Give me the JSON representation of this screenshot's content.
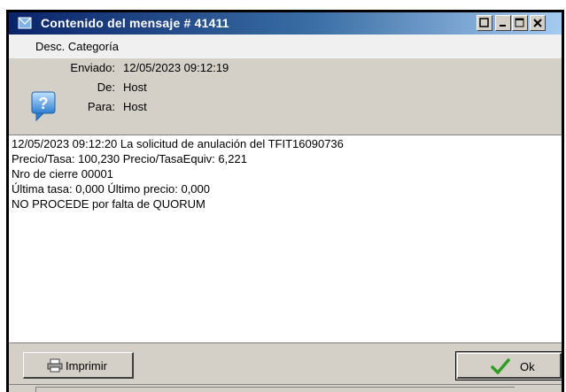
{
  "window": {
    "title": "Contenido del mensaje # 41411",
    "controls": [
      "help",
      "minimize",
      "maximize",
      "close"
    ]
  },
  "menu": {
    "items": [
      "Desc. Categoría"
    ]
  },
  "header": {
    "icon": "help-speech-bubble-icon",
    "fields": [
      {
        "label": "Enviado:",
        "value": "12/05/2023 09:12:19"
      },
      {
        "label": "De:",
        "value": "Host"
      },
      {
        "label": "Para:",
        "value": "Host"
      }
    ]
  },
  "message": {
    "lines": [
      "12/05/2023 09:12:20 La solicitud de anulación del TFIT16090736",
      "Precio/Tasa: 100,230 Precio/TasaEquiv: 6,221",
      "Nro de cierre 00001",
      "Última tasa: 0,000 Último precio: 0,000",
      "NO PROCEDE por falta de QUORUM"
    ]
  },
  "buttons": {
    "print_label": "Imprimir",
    "ok_label": "Ok"
  },
  "colors": {
    "title_gradient_start": "#0a246a",
    "title_gradient_end": "#a6caf0",
    "chrome": "#d4d0c8",
    "ok_check": "#2e9e1e"
  }
}
